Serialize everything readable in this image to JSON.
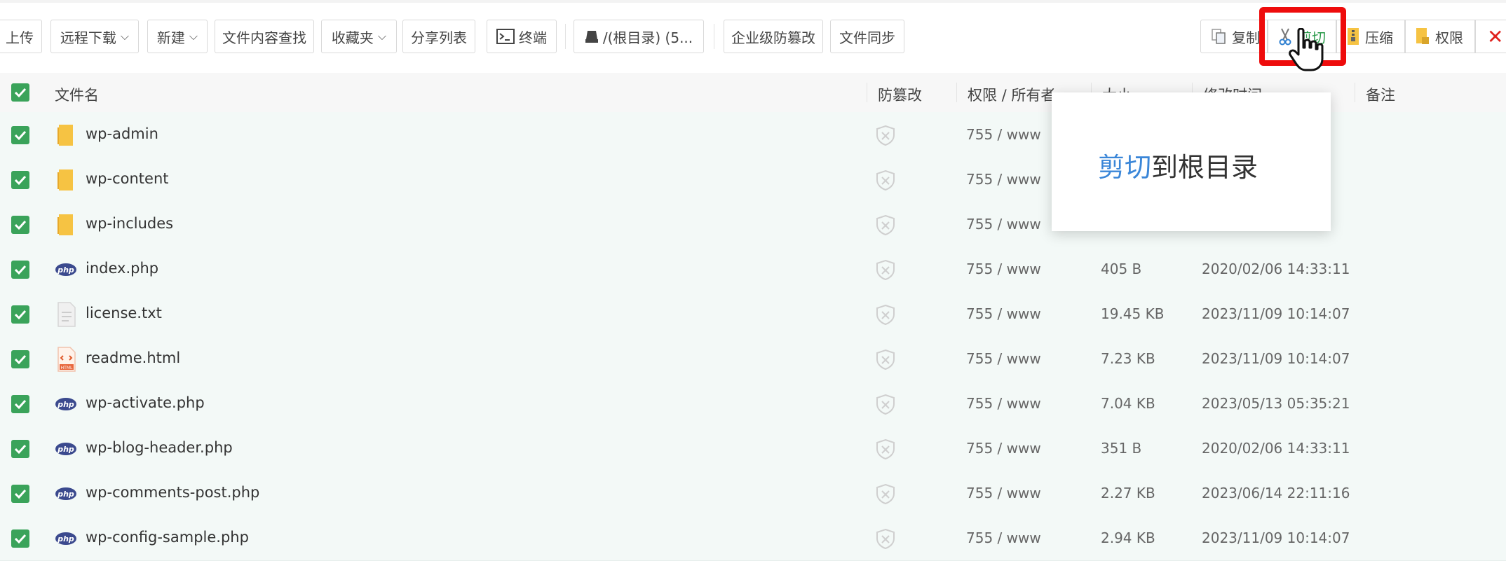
{
  "toolbar": {
    "upload": "上传",
    "remote_download": "远程下载",
    "new": "新建",
    "content_search": "文件内容查找",
    "favorites": "收藏夹",
    "share_list": "分享列表",
    "terminal": "终端",
    "path": "/(根目录) (5...",
    "enterprise_tamper": "企业级防篡改",
    "file_sync": "文件同步",
    "copy": "复制",
    "cut": "剪切",
    "compress": "压缩",
    "permission": "权限",
    "close_symbol": "✕"
  },
  "columns": {
    "name": "文件名",
    "tamper": "防篡改",
    "owner": "权限 / 所有者",
    "size": "大小",
    "mtime": "修改时间",
    "note": "备注"
  },
  "files": [
    {
      "name": "wp-admin",
      "type": "folder",
      "perm": "755 / www",
      "size": "",
      "mtime": ""
    },
    {
      "name": "wp-content",
      "type": "folder",
      "perm": "755 / www",
      "size": "",
      "mtime": ""
    },
    {
      "name": "wp-includes",
      "type": "folder",
      "perm": "755 / www",
      "size": "",
      "mtime": ""
    },
    {
      "name": "index.php",
      "type": "php",
      "perm": "755 / www",
      "size": "405 B",
      "mtime": "2020/02/06 14:33:11"
    },
    {
      "name": "license.txt",
      "type": "txt",
      "perm": "755 / www",
      "size": "19.45 KB",
      "mtime": "2023/11/09 10:14:07"
    },
    {
      "name": "readme.html",
      "type": "html",
      "perm": "755 / www",
      "size": "7.23 KB",
      "mtime": "2023/11/09 10:14:07"
    },
    {
      "name": "wp-activate.php",
      "type": "php",
      "perm": "755 / www",
      "size": "7.04 KB",
      "mtime": "2023/05/13 05:35:21"
    },
    {
      "name": "wp-blog-header.php",
      "type": "php",
      "perm": "755 / www",
      "size": "351 B",
      "mtime": "2020/02/06 14:33:11"
    },
    {
      "name": "wp-comments-post.php",
      "type": "php",
      "perm": "755 / www",
      "size": "2.27 KB",
      "mtime": "2023/06/14 22:11:16"
    },
    {
      "name": "wp-config-sample.php",
      "type": "php",
      "perm": "755 / www",
      "size": "2.94 KB",
      "mtime": "2023/11/09 10:14:07"
    }
  ],
  "tooltip": {
    "action": "剪切",
    "target": "到根目录"
  },
  "icons": {
    "php_label": "php",
    "html_label": "HTML"
  },
  "colors": {
    "checkbox": "#3aa35a",
    "row_selected": "#f3f9f7",
    "highlight": "#ee0c0c",
    "tooltip_accent": "#3a86d8",
    "folder": "#f6c343"
  }
}
